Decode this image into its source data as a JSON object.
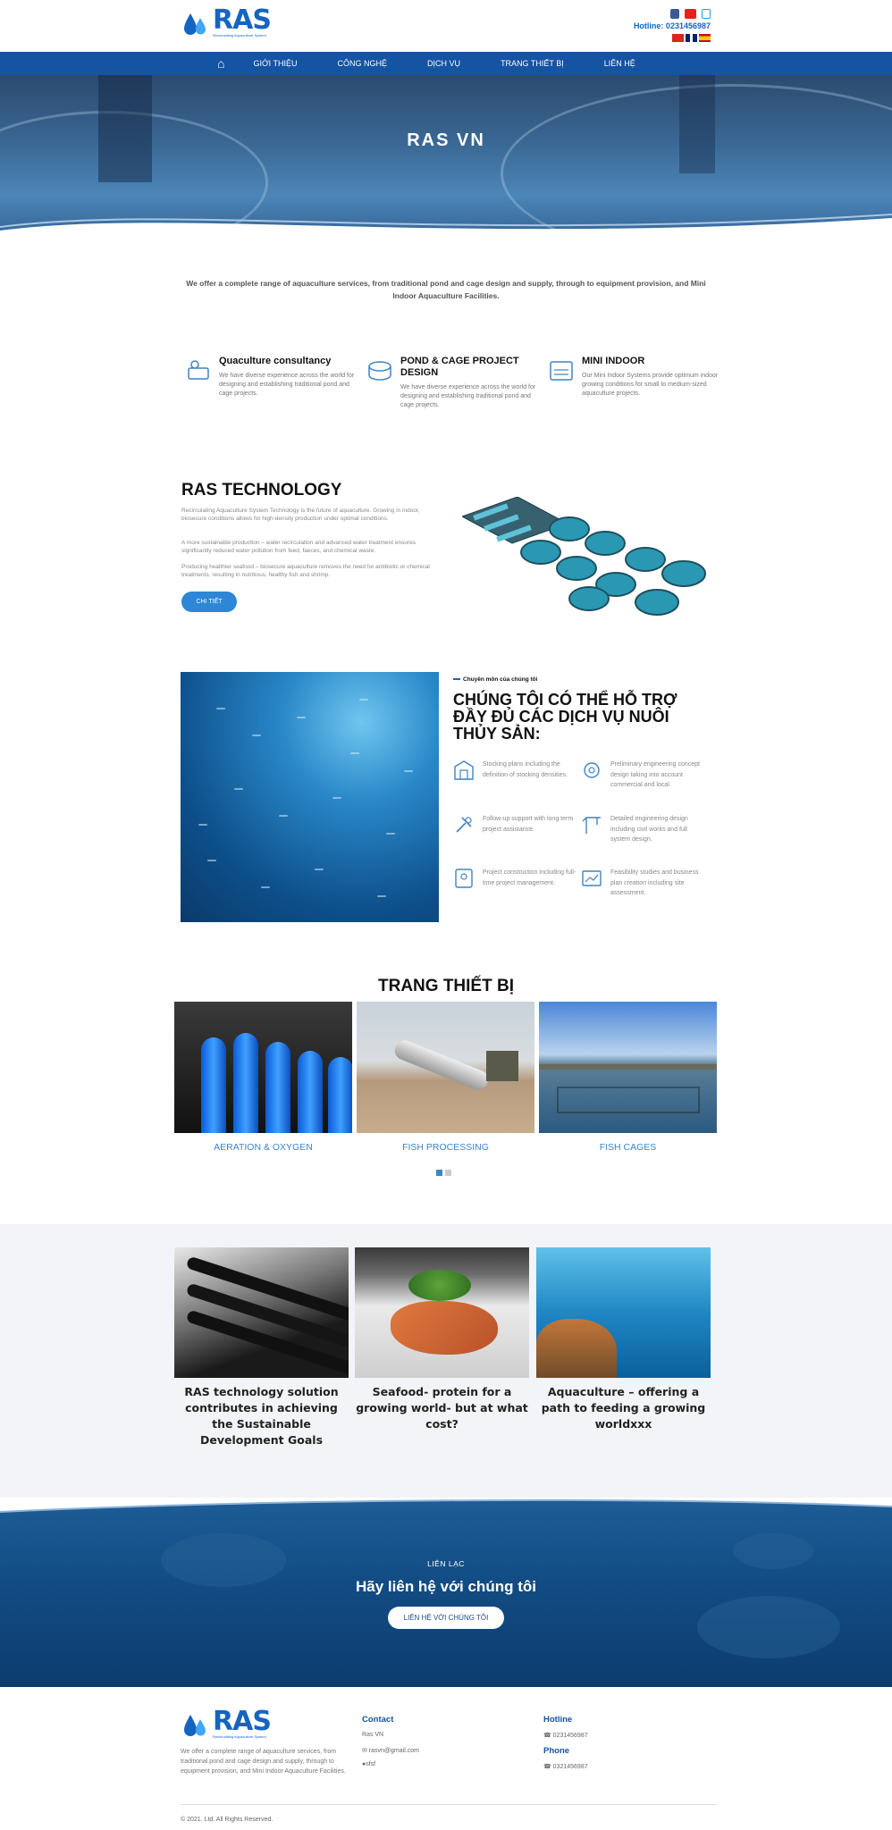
{
  "brand": {
    "name": "RAS",
    "tagline": "Recirculating Aquaculture System"
  },
  "header": {
    "hotline": "Hotline: 0231456987",
    "social": [
      "facebook-icon",
      "youtube-icon",
      "twitter-icon"
    ],
    "languages": [
      "vietnamese-flag",
      "english-flag",
      "spanish-flag"
    ]
  },
  "nav": {
    "items": [
      "GIỚI THIỆU",
      "CÔNG NGHỆ",
      "DỊCH VỤ",
      "TRANG THIẾT BỊ",
      "LIÊN HỆ"
    ]
  },
  "hero": {
    "title": "RAS VN"
  },
  "intro": "We offer a complete range of aquaculture services, from traditional pond and cage design and supply, through to equipment provision, and Mini Indoor Aquaculture Facilities.",
  "services": [
    {
      "title": "Quaculture consultancy",
      "text": "We have diverse experience across the world for designing and establishing traditional pond and cage projects."
    },
    {
      "title": "POND & CAGE PROJECT DESIGN",
      "text": "We have diverse experience across the world for designing and establishing traditional pond and cage projects."
    },
    {
      "title": "MINI INDOOR",
      "text": "Our Mini Indoor Systems provide optimum indoor growing conditions for small to medium-sized aquaculture projects."
    }
  ],
  "ras": {
    "title": "RAS TECHNOLOGY",
    "p1": "Recirculating Aquaculture System Technology is the future of aquaculture. Growing in indoor, biosecure conditions allows for high-density production under optimal conditions.",
    "p2": "A more sustainable production – water recirculation and advanced water treatment ensures significantly reduced water pollution from feed, faeces, and chemical waste.",
    "p3": "Producing healthier seafood – biosecure aquaculture removes the need for antibiotic or chemical treatments, resulting in nutritious, healthy fish and shrimp.",
    "button": "CHI TIẾT"
  },
  "expertise": {
    "kicker": "Chuyên môn của chúng tôi",
    "title": "CHÚNG TÔI CÓ THỂ HỖ TRỢ ĐẦY ĐỦ CÁC DỊCH VỤ NUÔI THỦY SẢN:",
    "items": [
      {
        "icon": "farm-plan-icon",
        "text": "Stocking plans including the definition of stocking densities."
      },
      {
        "icon": "engineering-gear-icon",
        "text": "Preliminary engineering concept design taking into account commercial and local."
      },
      {
        "icon": "support-tools-icon",
        "text": "Follow-up support with long term project assistance."
      },
      {
        "icon": "crane-icon",
        "text": "Detailed engineering design including civil works and full system design."
      },
      {
        "icon": "project-manager-icon",
        "text": "Project construction including full-time project management."
      },
      {
        "icon": "business-plan-icon",
        "text": "Feasibility studies and business plan creation including site assessment."
      }
    ]
  },
  "equipment": {
    "title": "TRANG THIẾT BỊ",
    "items": [
      "AERATION & OXYGEN",
      "FISH PROCESSING",
      "FISH CAGES"
    ]
  },
  "news": [
    {
      "title": "RAS technology solution contributes in achieving the Sustainable Development Goals"
    },
    {
      "title": "Seafood- protein for a growing world- but at what cost?"
    },
    {
      "title": "Aquaculture – offering a path to feeding a growing worldxxx"
    }
  ],
  "contact": {
    "kicker": "LIÊN LẠC",
    "title": "Hãy liên hệ với chúng tôi",
    "button": "LIÊN HỆ VỚI CHÚNG TÔI"
  },
  "footer": {
    "desc": "We offer a complete range of aquaculture services, from traditional pond and cage design and supply, through to equipment provision, and Mini Indoor Aquaculture Facilities.",
    "contact_h": "Contact",
    "company": "Ras VN",
    "email": "rasvn@gmail.com",
    "address": "sfsf",
    "hotline_h": "Hotline",
    "hotline": "0231456987",
    "phone_h": "Phone",
    "phone": "0321456987",
    "copyright": "© 2021. Ltd. All Rights Reserved."
  },
  "colors": {
    "primary": "#1553a3",
    "accent": "#2d86d6",
    "label": "#3f84c4"
  }
}
